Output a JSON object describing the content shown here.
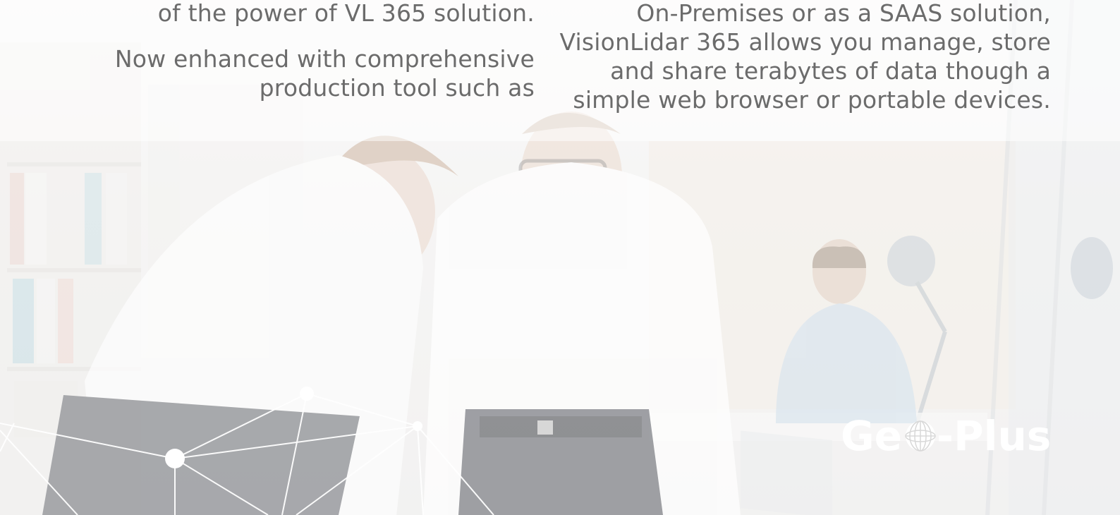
{
  "left_text": {
    "line1": "of the power of VL 365 solution.",
    "line2": "Now enhanced with comprehensive",
    "line3": "production tool such as"
  },
  "right_text": {
    "line1": "On-Premises or as a SAAS solution,",
    "line2": "VisionLidar 365 allows you manage, store",
    "line3": "and share terabytes of data though a",
    "line4": "simple web browser or portable devices."
  },
  "logo": {
    "text_left": "Ge",
    "text_right": "-Plus",
    "globe_icon": "globe-icon",
    "color": "#ffffff"
  },
  "colors": {
    "text": "#6b6b6b",
    "background": "#f4f3f2"
  }
}
